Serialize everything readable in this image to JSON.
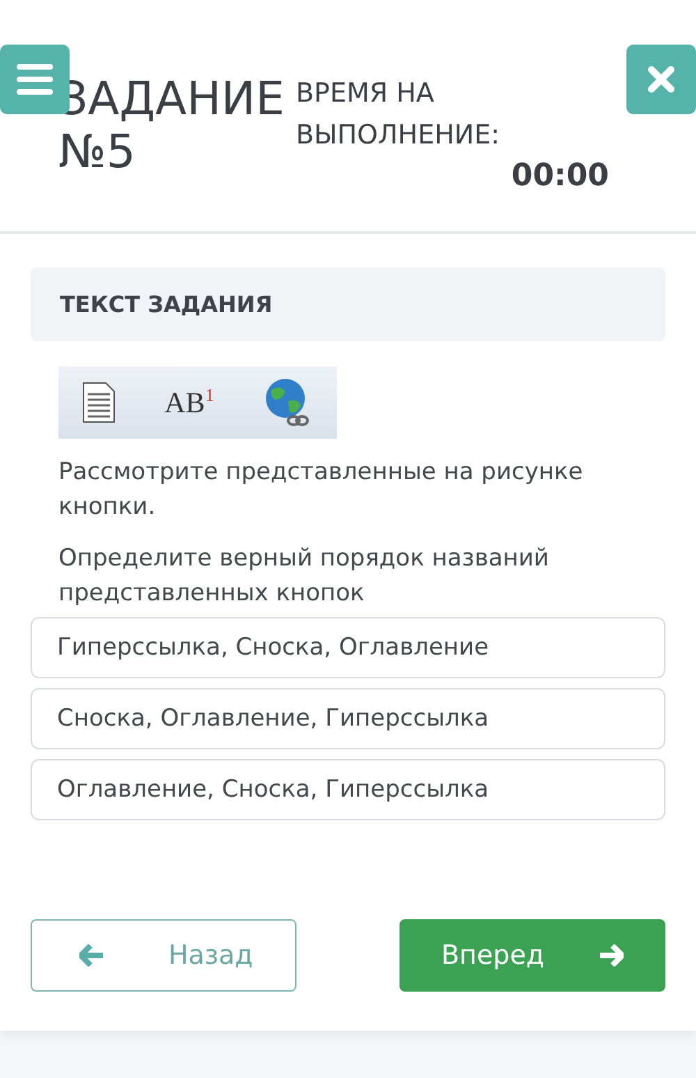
{
  "header": {
    "title_line_1": "ЗАДАНИЕ",
    "title_line_2": "№5",
    "timer_label": "ВРЕМЯ НА ВЫПОЛНЕНИЕ:",
    "timer_value": "00:00"
  },
  "task": {
    "heading": "ТЕКСТ ЗАДАНИЯ",
    "toolbar_label": "AB$^{1}$",
    "paragraphs": [
      "Рассмотрите представленные на рисунке кнопки.",
      "Определите верный порядок названий представленных кнопок"
    ]
  },
  "options": [
    {
      "label": "Гиперссылка, Сноска, Оглавление",
      "selected": false
    },
    {
      "label": "Сноска, Оглавление, Гиперссылка",
      "selected": false
    },
    {
      "label": "Оглавление, Сноска, Гиперссылка",
      "selected": false
    }
  ],
  "nav": {
    "back": "Назад",
    "next": "Вперед"
  }
}
